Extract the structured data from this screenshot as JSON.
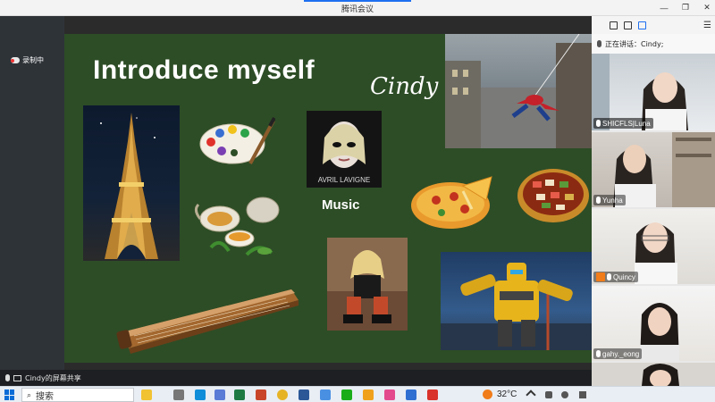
{
  "window": {
    "title": "腾讯会议"
  },
  "recording": {
    "label": "录制中"
  },
  "slide": {
    "title": "Introduce myself",
    "name": "Cindy",
    "music_label": "Music",
    "album_text": "AVRIL LAVIGNE"
  },
  "panel": {
    "speaking": "正在讲话：Cindy;",
    "participants": [
      {
        "name": "SHICFLS|Luna"
      },
      {
        "name": "Yunha"
      },
      {
        "name": "Quincy"
      },
      {
        "name": "gahy._eong"
      }
    ]
  },
  "share_bar": {
    "label": "Cindy的屏幕共享"
  },
  "taskbar": {
    "search_placeholder": "搜索",
    "temperature": "32°C",
    "apps": [
      "file-explorer",
      "edge",
      "files",
      "excel",
      "powerpoint",
      "chrome",
      "word",
      "tencent-meeting",
      "wechat",
      "app",
      "app",
      "wps"
    ]
  },
  "colors": {
    "slide_bg": "#2d4d26",
    "accent": "#1e6ff0",
    "left_bar": "#2e3338"
  }
}
